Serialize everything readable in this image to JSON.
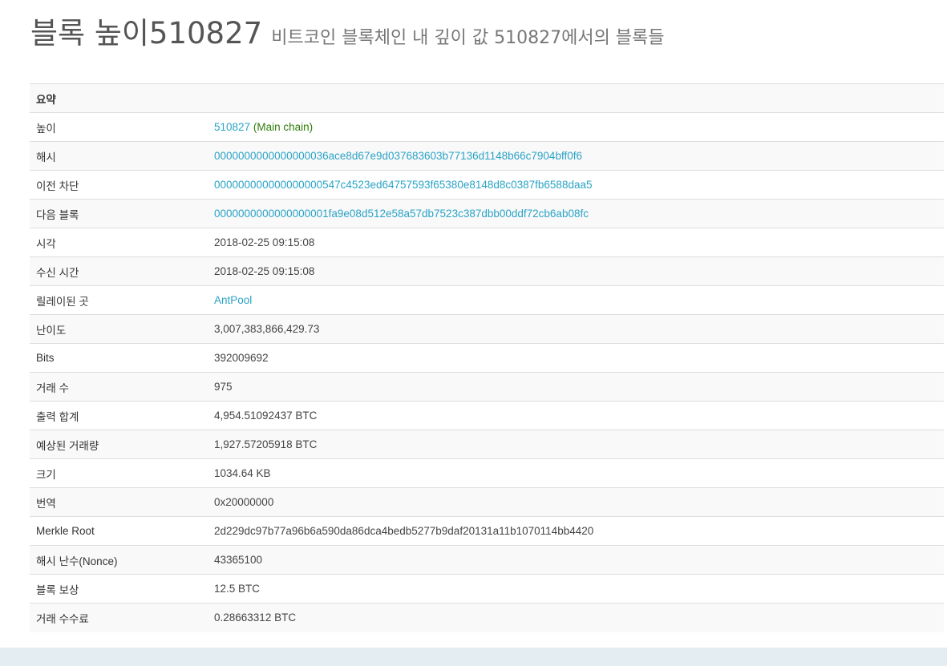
{
  "header": {
    "title": "블록 높이510827",
    "subtitle": "비트코인 블록체인 내 깊이 값 510827에서의 블록들"
  },
  "summary": {
    "heading": "요약",
    "rows": [
      {
        "label": "높이",
        "value": "510827",
        "suffix": "(Main chain)"
      },
      {
        "label": "해시",
        "value": "0000000000000000036ace8d67e9d037683603b77136d1148b66c7904bff0f6"
      },
      {
        "label": "이전 차단",
        "value": "000000000000000000547c4523ed64757593f65380e8148d8c0387fb6588daa5"
      },
      {
        "label": "다음 블록",
        "value": "0000000000000000001fa9e08d512e58a57db7523c387dbb00ddf72cb6ab08fc"
      },
      {
        "label": "시각",
        "value": "2018-02-25 09:15:08"
      },
      {
        "label": "수신 시간",
        "value": "2018-02-25 09:15:08"
      },
      {
        "label": "릴레이된 곳",
        "value": "AntPool"
      },
      {
        "label": "난이도",
        "value": "3,007,383,866,429.73"
      },
      {
        "label": "Bits",
        "value": "392009692"
      },
      {
        "label": "거래 수",
        "value": "975"
      },
      {
        "label": "출력 합계",
        "value": "4,954.51092437 BTC"
      },
      {
        "label": "예상된 거래량",
        "value": "1,927.57205918 BTC"
      },
      {
        "label": "크기",
        "value": "1034.64 KB"
      },
      {
        "label": "번역",
        "value": "0x20000000"
      },
      {
        "label": "Merkle Root",
        "value": "2d229dc97b77a96b6a590da86dca4bedb5277b9daf20131a11b1070114bb4420"
      },
      {
        "label": "해시 난수(Nonce)",
        "value": "43365100"
      },
      {
        "label": "블록 보상",
        "value": "12.5 BTC"
      },
      {
        "label": "거래 수수료",
        "value": "0.28663312 BTC"
      }
    ]
  },
  "colors": {
    "link": "#2aa3c6",
    "main_chain": "#2e7d0a",
    "footer_band": "#e4eef2"
  }
}
